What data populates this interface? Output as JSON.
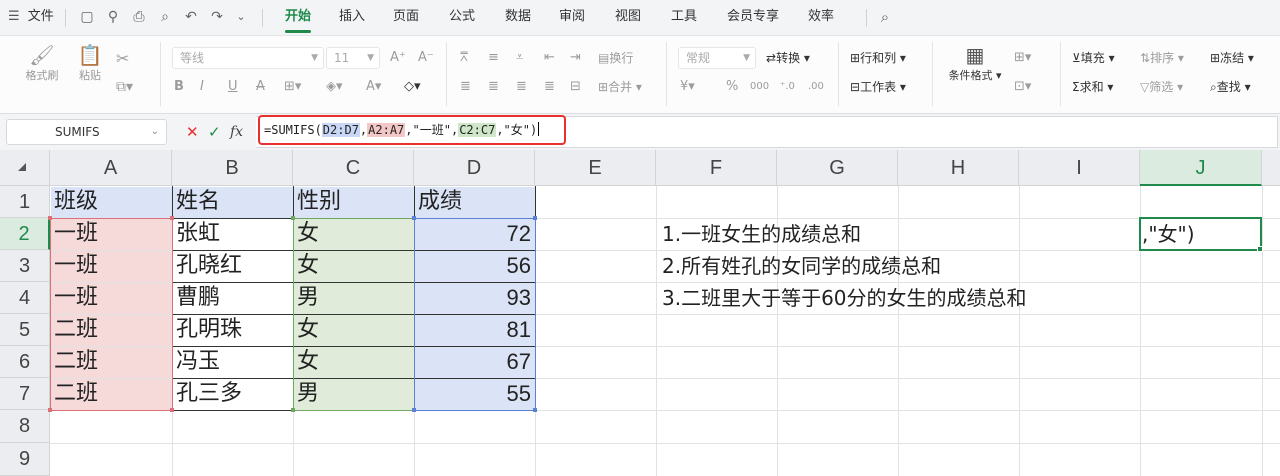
{
  "menubar": {
    "file_label": "文件",
    "tabs": [
      "开始",
      "插入",
      "页面",
      "公式",
      "数据",
      "审阅",
      "视图",
      "工具",
      "会员专享",
      "效率"
    ],
    "active_tab": "开始"
  },
  "ribbon": {
    "format_painter": "格式刷",
    "paste": "粘贴",
    "font_name": "等线",
    "font_size": "11",
    "wrap_text": "换行",
    "merge": "合并",
    "number_format": "常规",
    "convert": "转换",
    "rows_cols": "行和列",
    "worksheet": "工作表",
    "conditional_format": "条件格式",
    "fill": "填充",
    "sort": "排序",
    "freeze": "冻结",
    "sum": "求和",
    "filter": "筛选",
    "find": "查找"
  },
  "formula_bar": {
    "name_box": "SUMIFS",
    "formula_parts": [
      {
        "text": "=SUMIFS(",
        "color": "none"
      },
      {
        "text": "D2:D7",
        "color": "blue"
      },
      {
        "text": ",",
        "color": "none"
      },
      {
        "text": "A2:A7",
        "color": "red"
      },
      {
        "text": ",\"一班\",",
        "color": "none"
      },
      {
        "text": "C2:C7",
        "color": "green"
      },
      {
        "text": ",\"女\")",
        "color": "none"
      }
    ]
  },
  "sheet": {
    "columns": [
      "A",
      "B",
      "C",
      "D",
      "E",
      "F",
      "G",
      "H",
      "I",
      "J"
    ],
    "rows": [
      "1",
      "2",
      "3",
      "4",
      "5",
      "6",
      "7",
      "8",
      "9"
    ],
    "active_column": "J",
    "active_row": "2",
    "headers": [
      "班级",
      "姓名",
      "性别",
      "成绩"
    ],
    "data": [
      [
        "一班",
        "张虹",
        "女",
        "72"
      ],
      [
        "一班",
        "孔晓红",
        "女",
        "56"
      ],
      [
        "一班",
        "曹鹏",
        "男",
        "93"
      ],
      [
        "二班",
        "孔明珠",
        "女",
        "81"
      ],
      [
        "二班",
        "冯玉",
        "女",
        "67"
      ],
      [
        "二班",
        "孔三多",
        "男",
        "55"
      ]
    ],
    "notes": [
      "1.一班女生的成绩总和",
      "2.所有姓孔的女同学的成绩总和",
      "3.二班里大于等于60分的女生的成绩总和"
    ],
    "active_cell_text": ",\"女\")"
  },
  "colors": {
    "accent": "#1f8a4c",
    "ref_blue": "#dbe3f7",
    "ref_red": "#f6dada",
    "ref_green": "#e0ecd9",
    "formula_highlight": "#e8312f"
  }
}
